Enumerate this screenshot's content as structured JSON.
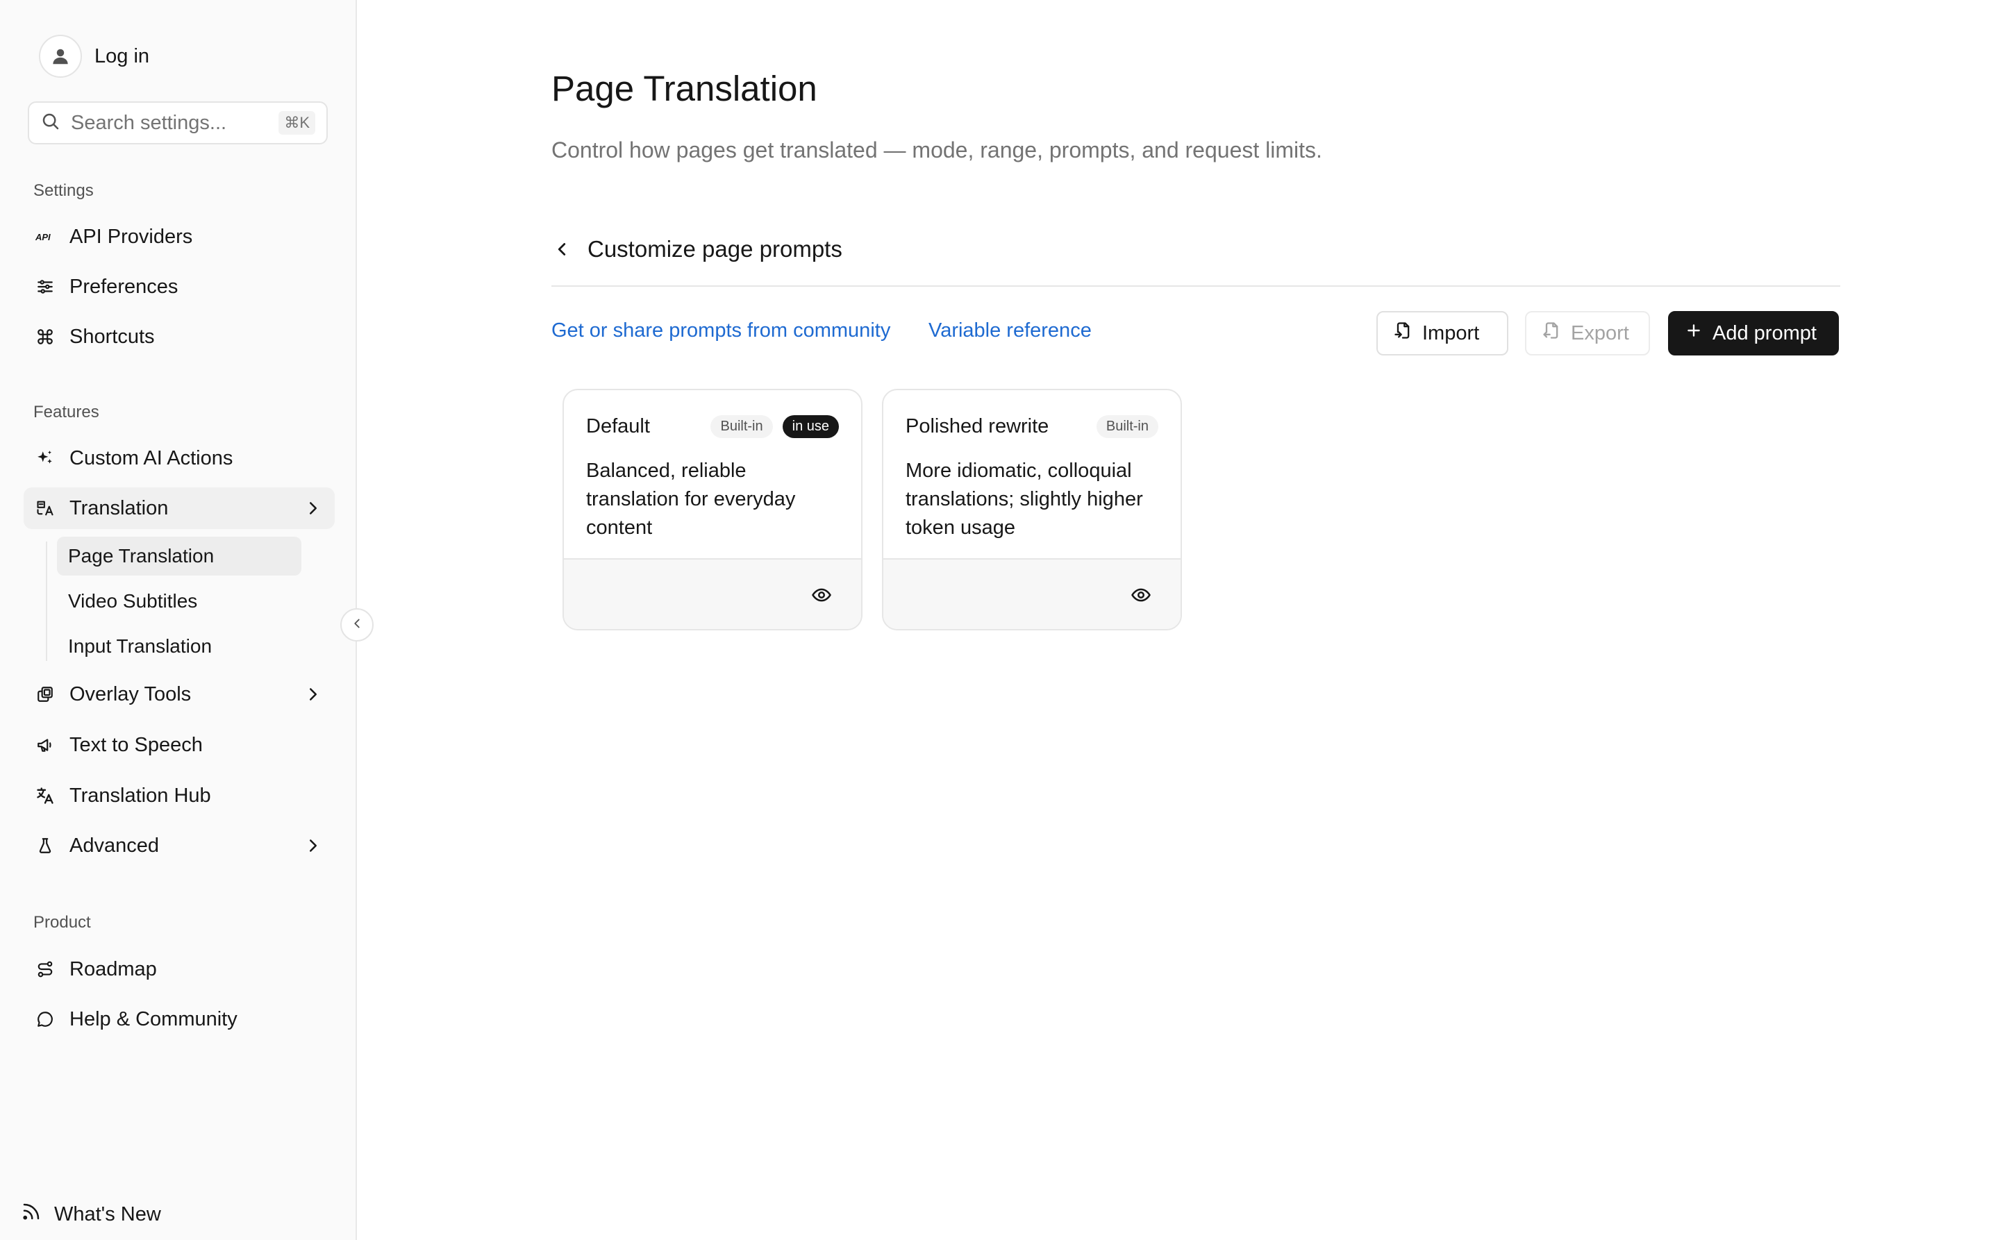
{
  "sidebar": {
    "login_label": "Log in",
    "search": {
      "placeholder": "Search settings...",
      "shortcut": "⌘K"
    },
    "sections": {
      "settings": "Settings",
      "features": "Features",
      "product": "Product"
    },
    "settings_items": [
      {
        "label": "API Providers",
        "icon": "api-icon"
      },
      {
        "label": "Preferences",
        "icon": "sliders-icon"
      },
      {
        "label": "Shortcuts",
        "icon": "command-icon"
      }
    ],
    "feature_items": [
      {
        "label": "Custom AI Actions",
        "icon": "sparkles-icon"
      },
      {
        "label": "Translation",
        "icon": "translate-icon",
        "expanded": true
      },
      {
        "label": "Overlay Tools",
        "icon": "layers-icon"
      },
      {
        "label": "Text to Speech",
        "icon": "megaphone-icon"
      },
      {
        "label": "Translation Hub",
        "icon": "languages-icon"
      },
      {
        "label": "Advanced",
        "icon": "flask-icon"
      }
    ],
    "translation_subitems": [
      {
        "label": "Page Translation",
        "active": true
      },
      {
        "label": "Video Subtitles"
      },
      {
        "label": "Input Translation"
      }
    ],
    "product_items": [
      {
        "label": "Roadmap",
        "icon": "route-icon"
      },
      {
        "label": "Help & Community",
        "icon": "chat-bubble-icon"
      }
    ],
    "whats_new": "What's New"
  },
  "main": {
    "title": "Page Translation",
    "description": "Control how pages get translated — mode, range, prompts, and request limits.",
    "subpage_title": "Customize page prompts",
    "links": {
      "community": "Get or share prompts from community",
      "variables": "Variable reference"
    },
    "buttons": {
      "import": "Import",
      "export": "Export",
      "add": "Add prompt"
    },
    "prompts": [
      {
        "name": "Default",
        "badge": "Built-in",
        "status": "in use",
        "description": "Balanced, reliable translation for everyday content"
      },
      {
        "name": "Polished rewrite",
        "badge": "Built-in",
        "status": "",
        "description": "More idiomatic, colloquial translations; slightly higher token usage"
      }
    ]
  },
  "colors": {
    "accent_link": "#1e6ad1",
    "primary_button": "#171717",
    "sidebar_bg": "#fafafa"
  }
}
